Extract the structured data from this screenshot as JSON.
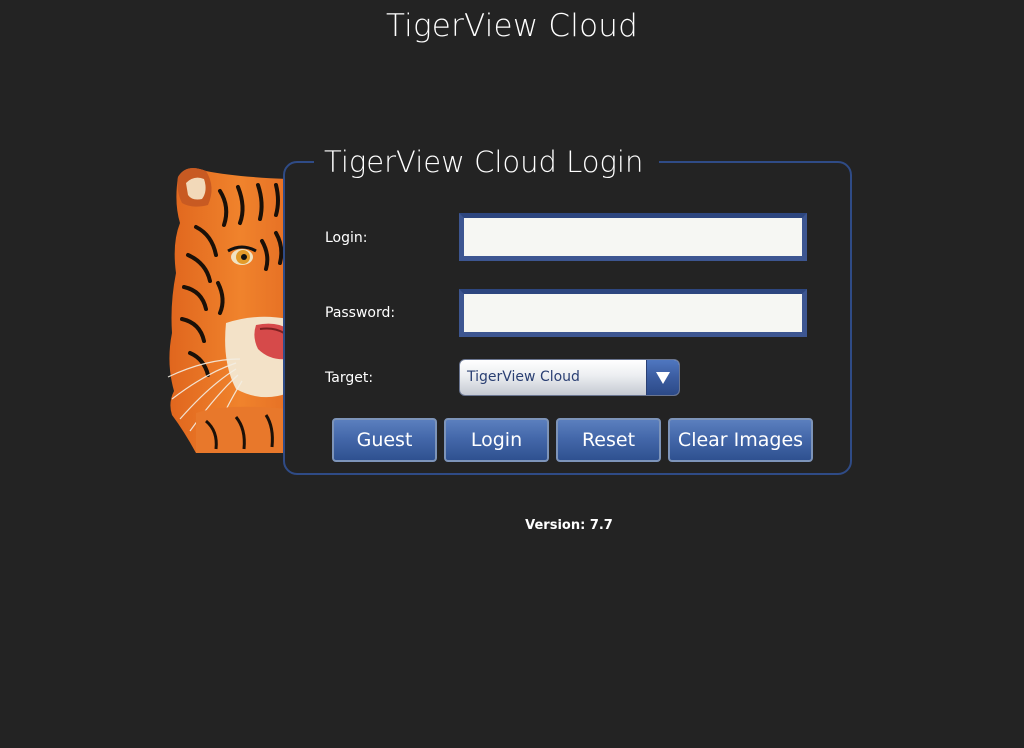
{
  "app_title": "TigerView Cloud",
  "login_panel": {
    "legend": "TigerView Cloud Login",
    "login_label": "Login:",
    "login_value": "",
    "password_label": "Password:",
    "password_value": "",
    "target_label": "Target:",
    "target_selected": "TigerView Cloud"
  },
  "buttons": {
    "guest": "Guest",
    "login": "Login",
    "reset": "Reset",
    "clear_images": "Clear Images"
  },
  "version_text": "Version: 7.7",
  "icons": {
    "tiger": "tiger-face-icon",
    "select_arrow": "triangle-down-icon"
  },
  "colors": {
    "background": "#232323",
    "panel_border": "#2f4b86",
    "button": "#4468aa",
    "input_border": "#3d5691"
  }
}
